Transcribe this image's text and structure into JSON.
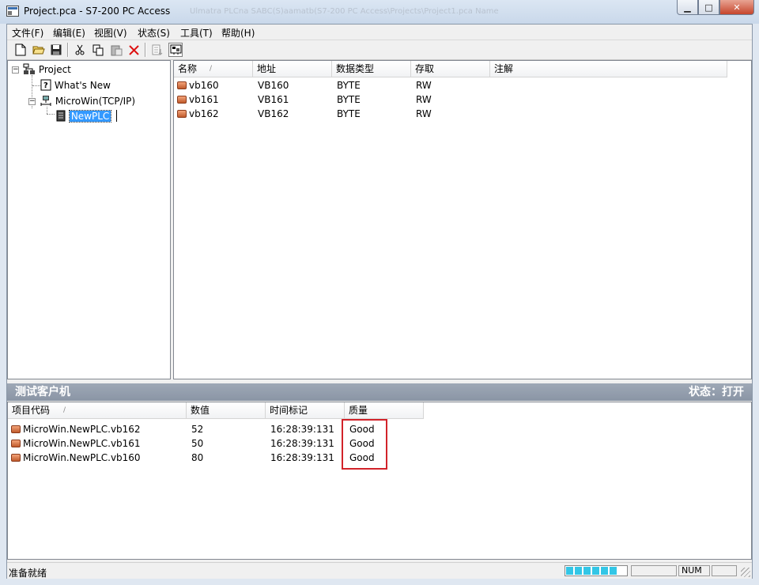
{
  "window": {
    "title": "Project.pca - S7-200 PC Access",
    "ghost_text": "Ulmatra PLCna  SABC(S)aamatb(S7-200  PC Access\\Projects\\Project1.pca Name",
    "min_glyph": "▁",
    "max_glyph": "□",
    "close_glyph": "✕"
  },
  "menu": [
    "文件(F)",
    "编辑(E)",
    "视图(V)",
    "状态(S)",
    "工具(T)",
    "帮助(H)"
  ],
  "toolbar": {
    "new": "🗋",
    "open": "📂",
    "save": "💾",
    "cut": "✂",
    "copy": "⎘",
    "paste": "📋",
    "delete": "✕",
    "properties": "▤",
    "test_client": "▣"
  },
  "tree": {
    "root": "Project",
    "whats_new": "What's New",
    "connection": "MicroWin(TCP/IP)",
    "plc": "NewPLC",
    "expander_minus": "−"
  },
  "items_table": {
    "columns": [
      "名称",
      "地址",
      "数据类型",
      "存取",
      "注解"
    ],
    "sort_glyph": "/",
    "rows": [
      {
        "name": "vb160",
        "address": "VB160",
        "type": "BYTE",
        "access": "RW",
        "comment": ""
      },
      {
        "name": "vb161",
        "address": "VB161",
        "type": "BYTE",
        "access": "RW",
        "comment": ""
      },
      {
        "name": "vb162",
        "address": "VB162",
        "type": "BYTE",
        "access": "RW",
        "comment": ""
      }
    ]
  },
  "test_client": {
    "title": "测试客户机",
    "status": "状态：打开",
    "columns": [
      "项目代码",
      "数值",
      "时间标记",
      "质量"
    ],
    "sort_glyph": "/",
    "rows": [
      {
        "item": "MicroWin.NewPLC.vb162",
        "value": "52",
        "timestamp": "16:28:39:131",
        "quality": "Good"
      },
      {
        "item": "MicroWin.NewPLC.vb161",
        "value": "50",
        "timestamp": "16:28:39:131",
        "quality": "Good"
      },
      {
        "item": "MicroWin.NewPLC.vb160",
        "value": "80",
        "timestamp": "16:28:39:131",
        "quality": "Good"
      }
    ]
  },
  "statusbar": {
    "text": "准备就绪",
    "num": "NUM",
    "progress_segments": 6
  },
  "colors": {
    "selection": "#3399ff",
    "highlight_box": "#d2232a",
    "progress": "#33c6e6",
    "panel_title": "#8a95a5"
  }
}
